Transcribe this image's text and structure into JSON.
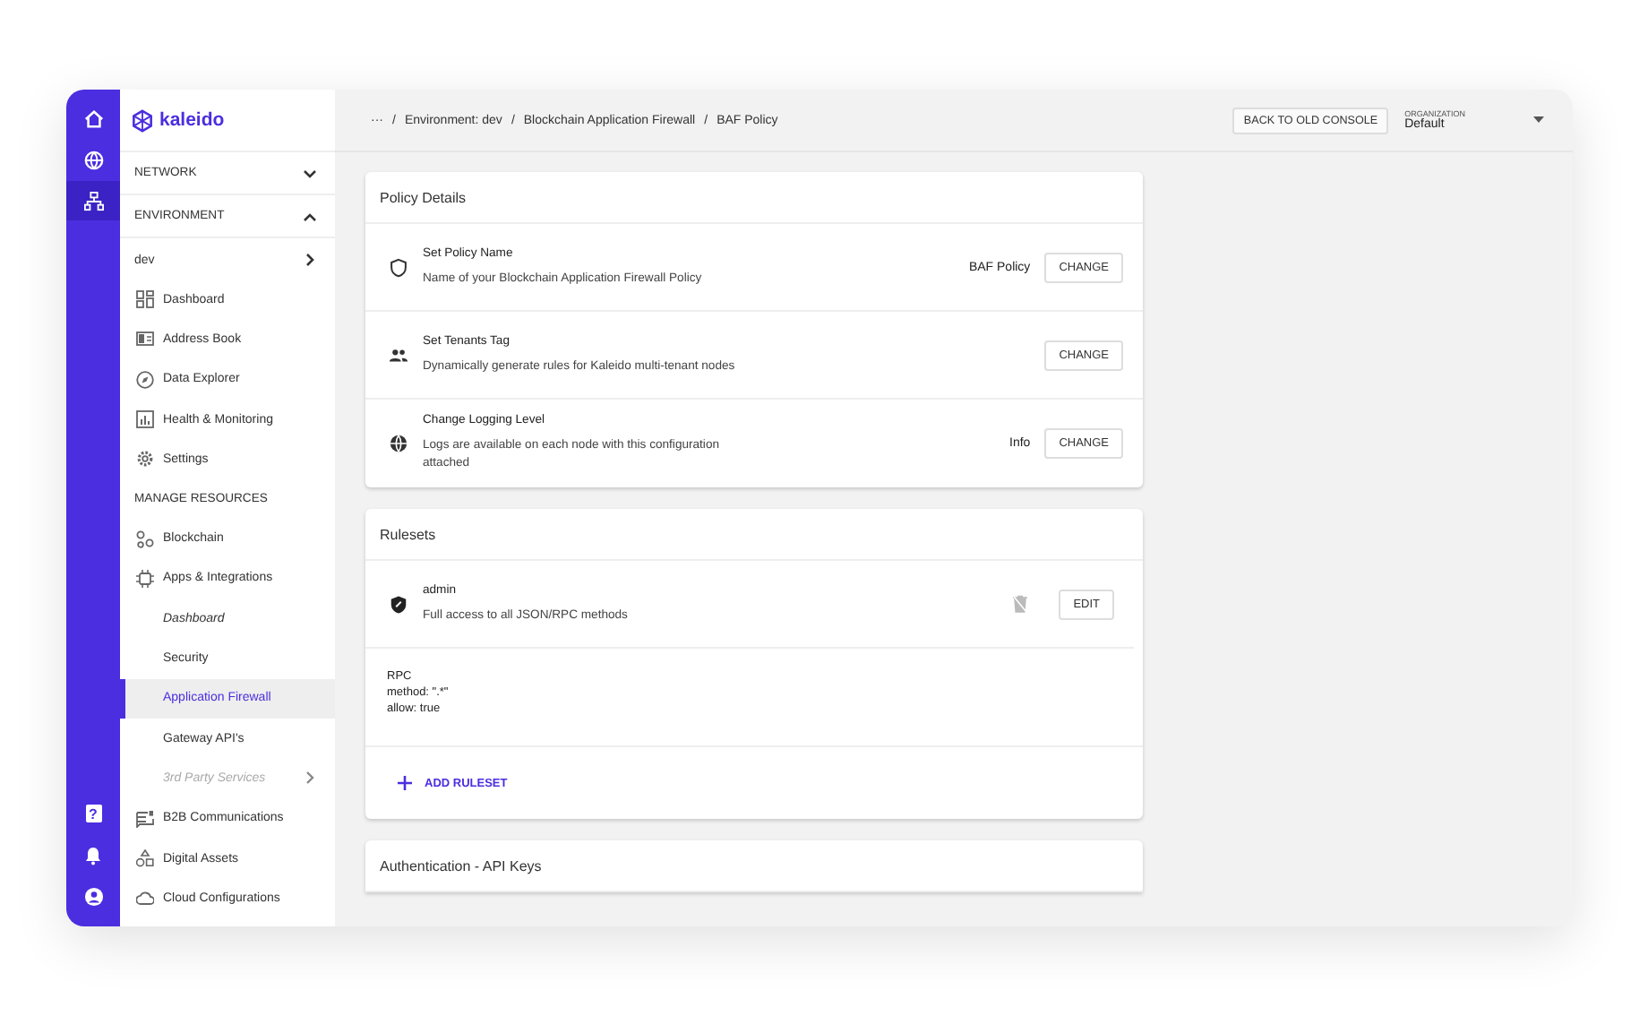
{
  "rail": {
    "top": [
      {
        "selected": false
      },
      {
        "selected": false
      },
      {
        "selected": true
      }
    ],
    "bottom": [
      "?"
    ]
  },
  "sidebar": {
    "logo": "kaleido",
    "items": [
      {
        "kind": "section",
        "label": "NETWORK",
        "expanded": false
      },
      {
        "kind": "section",
        "label": "ENVIRONMENT",
        "expanded": true
      },
      {
        "kind": "env",
        "label": "dev"
      },
      {
        "kind": "nav",
        "label": "Dashboard"
      },
      {
        "kind": "nav",
        "label": "Address Book"
      },
      {
        "kind": "nav",
        "label": "Data Explorer"
      },
      {
        "kind": "nav",
        "label": "Health & Monitoring"
      },
      {
        "kind": "nav",
        "label": "Settings"
      },
      {
        "kind": "heading",
        "label": "MANAGE RESOURCES"
      },
      {
        "kind": "nav",
        "label": "Blockchain"
      },
      {
        "kind": "nav",
        "label": "Apps & Integrations"
      },
      {
        "kind": "sub",
        "label": "Dashboard",
        "selected": false,
        "disabled": false,
        "italic": true
      },
      {
        "kind": "sub",
        "label": "Security",
        "selected": false,
        "disabled": false,
        "italic": false
      },
      {
        "kind": "sub",
        "label": "Application Firewall",
        "selected": true,
        "disabled": false,
        "italic": false
      },
      {
        "kind": "sub",
        "label": "Gateway API's",
        "selected": false,
        "disabled": false,
        "italic": false
      },
      {
        "kind": "sub",
        "label": "3rd Party Services",
        "selected": false,
        "disabled": true,
        "italic": true
      },
      {
        "kind": "nav",
        "label": "B2B Communications"
      },
      {
        "kind": "nav",
        "label": "Digital Assets"
      },
      {
        "kind": "nav",
        "label": "Cloud Configurations"
      }
    ]
  },
  "breadcrumb": {
    "separator": "/",
    "items": [
      "···",
      "Environment: dev",
      "Blockchain Application Firewall",
      "BAF Policy"
    ]
  },
  "topbar": {
    "back_button": "BACK TO OLD CONSOLE",
    "organization": {
      "label": "ORGANIZATION",
      "value": "Default"
    }
  },
  "policy_details": {
    "title": "Policy Details",
    "rows": [
      {
        "title": "Set Policy Name",
        "description": "Name of your Blockchain Application Firewall Policy",
        "value": "BAF Policy",
        "button": "CHANGE"
      },
      {
        "title": "Set Tenants Tag",
        "description": "Dynamically generate rules for Kaleido multi-tenant nodes",
        "button": "CHANGE"
      },
      {
        "title": "Change Logging Level",
        "description": "Logs are available on each node with this configuration attached",
        "value": "Info",
        "button": "CHANGE"
      }
    ]
  },
  "rulesets": {
    "title": "Rulesets",
    "items": [
      {
        "name": "admin",
        "description": "Full access to all JSON/RPC methods",
        "button": "EDIT",
        "rules": [
          "RPC",
          "method: \".*\"",
          "allow: true"
        ]
      }
    ],
    "add_button": "ADD RULESET"
  },
  "auth": {
    "title": "Authentication - API Keys"
  }
}
